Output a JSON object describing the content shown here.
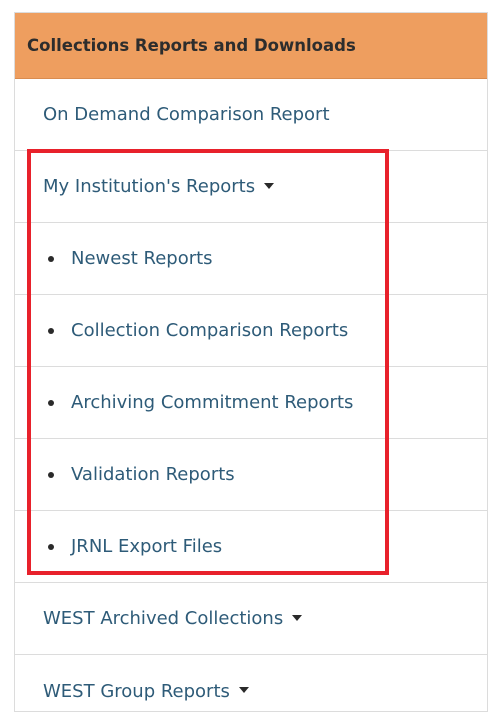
{
  "panel": {
    "title": "Collections Reports and Downloads",
    "items": [
      {
        "label": "On Demand Comparison Report"
      },
      {
        "label": "My Institution's Reports"
      },
      {
        "label": "Newest Reports"
      },
      {
        "label": "Collection Comparison Reports"
      },
      {
        "label": "Archiving Commitment Reports"
      },
      {
        "label": "Validation Reports"
      },
      {
        "label": "JRNL Export Files"
      },
      {
        "label": "WEST Archived Collections"
      },
      {
        "label": "WEST Group Reports"
      }
    ]
  },
  "colors": {
    "header_bg": "#ee9e5f",
    "link_text": "#2e5b78",
    "highlight_border": "#e8212b"
  }
}
